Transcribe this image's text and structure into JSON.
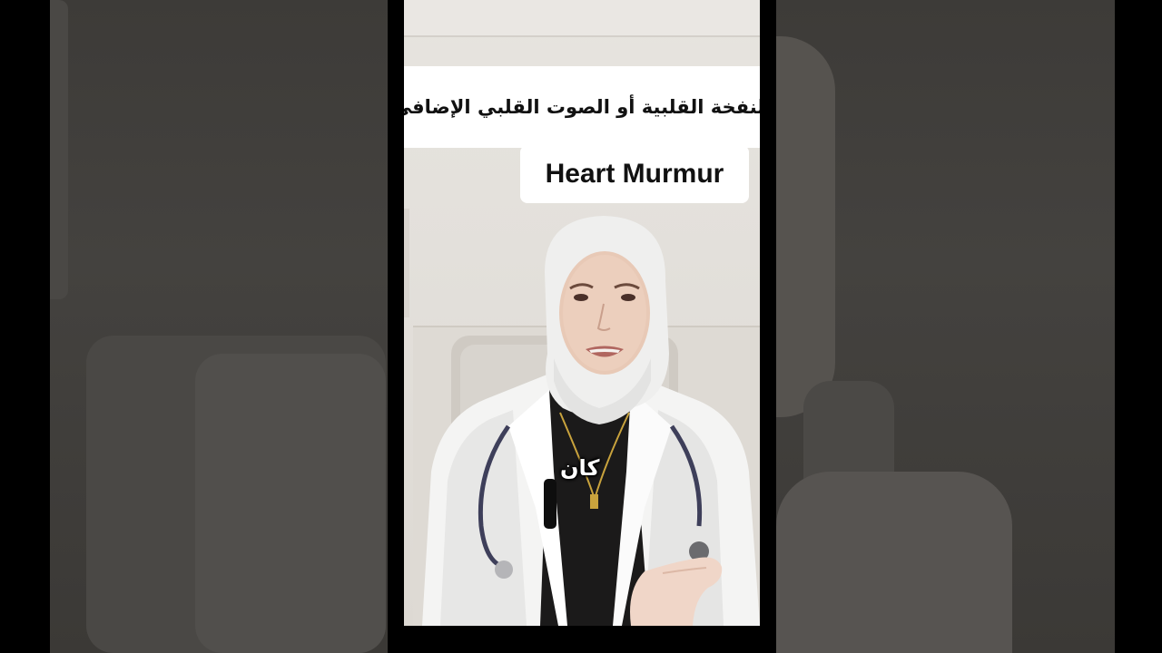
{
  "captions": {
    "arabic_title": "النفخة القلبية أو الصوت القلبي الإضافي",
    "english_title": "Heart Murmur",
    "spoken_word": "كان"
  },
  "colors": {
    "side_background": "#3d3b38",
    "wall": "#e5e2dd",
    "caption_box": "#ffffff",
    "caption_text": "#111111"
  }
}
